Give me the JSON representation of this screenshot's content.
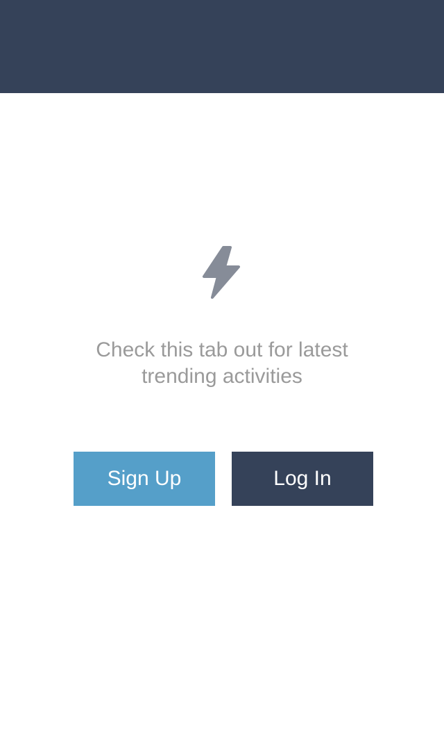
{
  "header": {
    "background": "#354259"
  },
  "empty_state": {
    "icon": "lightning-bolt-icon",
    "icon_color": "#868c98",
    "message_line1": "Check this tab out for latest",
    "message_line2": "trending activities",
    "text_color": "#9a9a9a"
  },
  "actions": {
    "signup_label": "Sign Up",
    "signup_color": "#559fc9",
    "login_label": "Log In",
    "login_color": "#354259"
  }
}
